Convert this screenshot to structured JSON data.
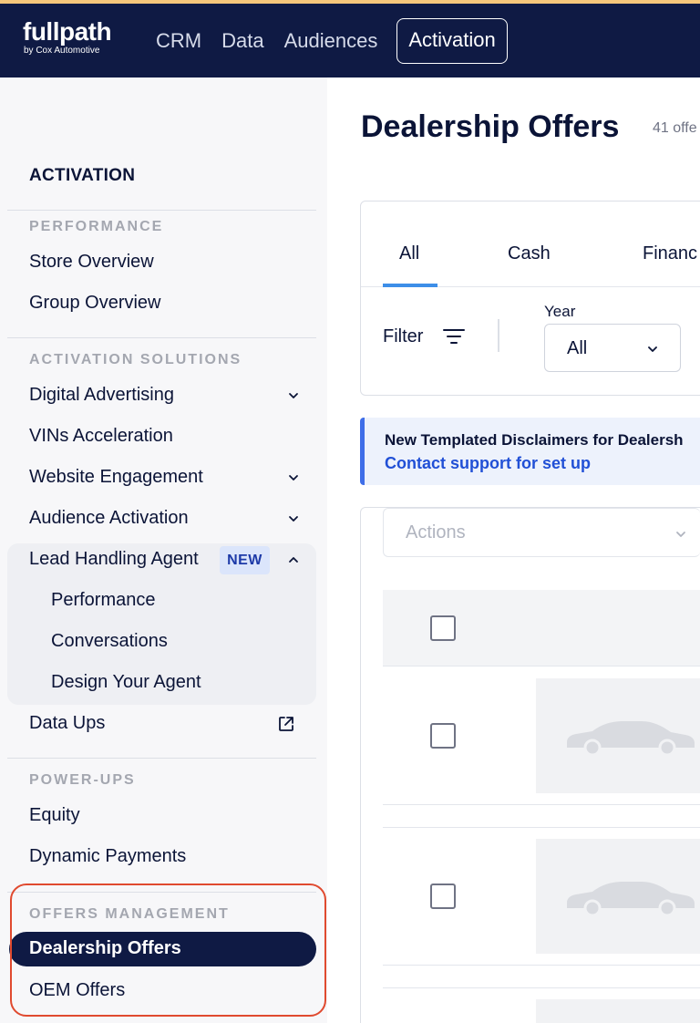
{
  "header": {
    "logo_main": "fullpath",
    "logo_sub": "by Cox Automotive",
    "nav": [
      "CRM",
      "Data",
      "Audiences",
      "Activation"
    ],
    "active_nav": "Activation"
  },
  "sidebar": {
    "title": "ACTIVATION",
    "sections": {
      "performance": "PERFORMANCE",
      "activation_solutions": "ACTIVATION SOLUTIONS",
      "power_ups": "POWER-UPS",
      "offers_management": "OFFERS MANAGEMENT"
    },
    "items": {
      "store_overview": "Store Overview",
      "group_overview": "Group Overview",
      "digital_advertising": "Digital Advertising",
      "vins_acceleration": "VINs Acceleration",
      "website_engagement": "Website Engagement",
      "audience_activation": "Audience Activation",
      "lead_handling_agent": "Lead Handling Agent",
      "lead_badge": "NEW",
      "performance": "Performance",
      "conversations": "Conversations",
      "design_your_agent": "Design Your Agent",
      "data_ups": "Data Ups",
      "equity": "Equity",
      "dynamic_payments": "Dynamic Payments",
      "dealership_offers": "Dealership Offers",
      "oem_offers": "OEM Offers"
    }
  },
  "main": {
    "title": "Dealership Offers",
    "offer_count": "41 offe",
    "tabs": [
      "All",
      "Cash",
      "Financ"
    ],
    "active_tab": "All",
    "filter_label": "Filter",
    "year_label": "Year",
    "year_value": "All",
    "banner_title": "New Templated Disclaimers for Dealersh",
    "banner_link": "Contact support for set up",
    "actions_placeholder": "Actions"
  },
  "colors": {
    "header_bg": "#0f1a44",
    "accent": "#3d8ee8",
    "highlight": "#e04a2f"
  }
}
